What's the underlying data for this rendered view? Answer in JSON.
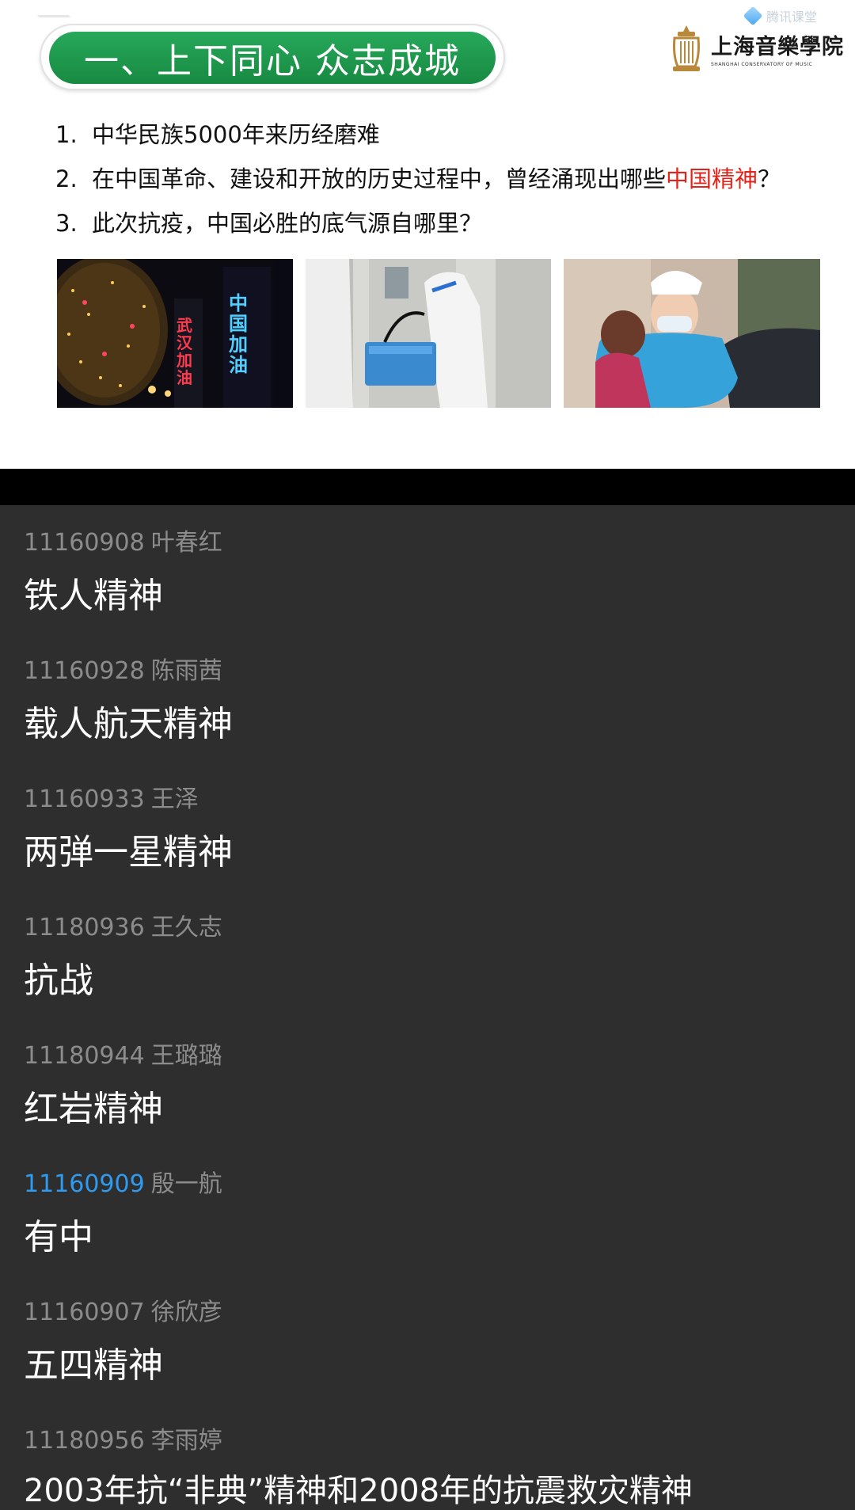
{
  "slide": {
    "title": "一、上下同心  众志成城",
    "watermark": "腾讯课堂",
    "logo": {
      "name_cn": "上海音樂學院",
      "name_en": "SHANGHAI CONSERVATORY OF MUSIC"
    },
    "questions": [
      {
        "number": "1.",
        "text": "中华民族5000年来历经磨难"
      },
      {
        "number": "2.",
        "text": "在中国革命、建设和开放的历史过程中，曾经涌现出哪些",
        "highlight": "中国精神",
        "suffix": "？"
      },
      {
        "number": "3.",
        "text": "此次抗疫，中国必胜的底气源自哪里？"
      }
    ],
    "photo_signs": [
      "武汉加油",
      "中国加油"
    ],
    "colors": {
      "title_green": "#1f9a4e",
      "highlight_red": "#e0241b"
    }
  },
  "messages": [
    {
      "id": "11160908",
      "name": "叶春红",
      "text": "铁人精神"
    },
    {
      "id": "11160928",
      "name": "陈雨茜",
      "text": "载人航天精神"
    },
    {
      "id": "11160933",
      "name": "王泽",
      "text": "两弹一星精神"
    },
    {
      "id": "11180936",
      "name": "王久志",
      "text": "抗战"
    },
    {
      "id": "11180944",
      "name": "王璐璐",
      "text": "红岩精神"
    },
    {
      "id": "11160909",
      "name": "殷一航",
      "text": "有中",
      "highlight": true
    },
    {
      "id": "11160907",
      "name": "徐欣彦",
      "text": "五四精神"
    },
    {
      "id": "11180956",
      "name": "李雨婷",
      "text": "2003年抗“非典”精神和2008年的抗震救灾精神"
    }
  ],
  "colors": {
    "chat_bg": "#2e2e2e",
    "meta_gray": "#8c8c8c",
    "id_highlight_blue": "#2e9bf0"
  }
}
